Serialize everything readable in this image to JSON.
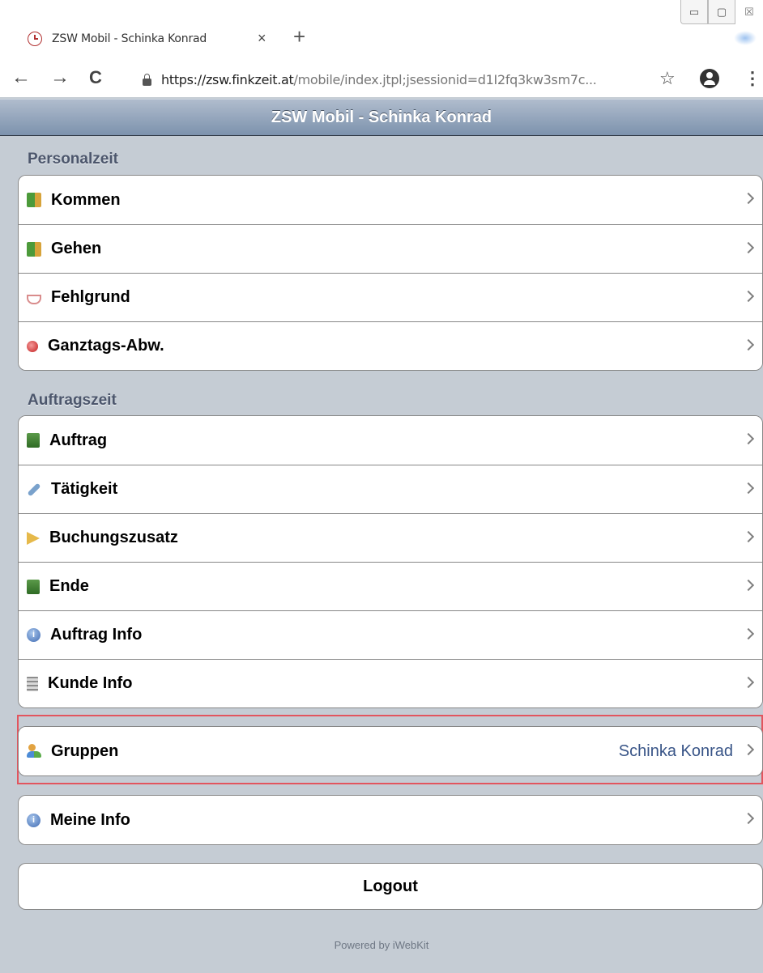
{
  "browser": {
    "tab_title": "ZSW Mobil - Schinka Konrad",
    "tab_close": "×",
    "new_tab": "+",
    "url_host": "https://zsw.finkzeit.at",
    "url_path": "/mobile/index.jtpl;jsessionid=d1I2fq3kw3sm7c...",
    "nav": {
      "back": "←",
      "forward": "→",
      "reload": "C"
    },
    "window_controls": {
      "minimize": "▭",
      "maximize": "▢",
      "close": "☒"
    },
    "bookmark_icon": "☆",
    "menu_icon": "⋮"
  },
  "header": {
    "title": "ZSW Mobil - Schinka Konrad"
  },
  "sections": [
    {
      "label": "Personalzeit",
      "items": [
        {
          "label": "Kommen",
          "icon": "door-in-icon"
        },
        {
          "label": "Gehen",
          "icon": "door-out-icon"
        },
        {
          "label": "Fehlgrund",
          "icon": "cup-icon"
        },
        {
          "label": "Ganztags-Abw.",
          "icon": "pill-icon"
        }
      ]
    },
    {
      "label": "Auftragszeit",
      "items": [
        {
          "label": "Auftrag",
          "icon": "signpost-icon"
        },
        {
          "label": "Tätigkeit",
          "icon": "wrench-icon"
        },
        {
          "label": "Buchungszusatz",
          "icon": "tag-icon"
        },
        {
          "label": "Ende",
          "icon": "signpost-icon"
        },
        {
          "label": "Auftrag Info",
          "icon": "info-icon"
        },
        {
          "label": "Kunde Info",
          "icon": "building-icon"
        }
      ]
    }
  ],
  "gruppen": {
    "label": "Gruppen",
    "value": "Schinka Konrad",
    "icon": "group-icon"
  },
  "meine_info": {
    "label": "Meine Info",
    "icon": "info-icon"
  },
  "logout": {
    "label": "Logout"
  },
  "footer": {
    "text": "Powered by iWebKit"
  },
  "colors": {
    "header_top": "#b0bccd",
    "header_bottom": "#7c92ad",
    "background": "#c5ccd4",
    "highlight": "#e2555e",
    "value_text": "#385487"
  }
}
